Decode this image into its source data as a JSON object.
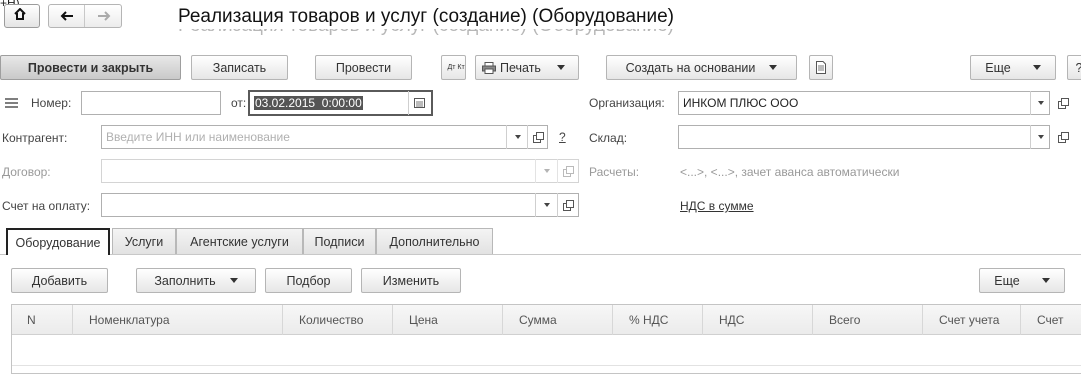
{
  "window": {
    "corner_label": "+H)",
    "title": "Реализация товаров и услуг (создание) (Оборудование)"
  },
  "toolbar": {
    "post_and_close": "Провести и закрыть",
    "save": "Записать",
    "post": "Провести",
    "dtkt_icon_text": "Дт Кт",
    "print": "Печать",
    "create_based_on": "Создать на основании",
    "more": "Еще",
    "help": "?"
  },
  "form": {
    "number_label": "Номер:",
    "number_value": "",
    "date_label": "от:",
    "date_value": "03.02.2015  0:00:00",
    "organization_label": "Организация:",
    "organization_value": "ИНКОМ ПЛЮС ООО",
    "counterparty_label": "Контрагент:",
    "counterparty_placeholder": "Введите ИНН или наименование",
    "counterparty_help": "?",
    "warehouse_label": "Склад:",
    "warehouse_value": "",
    "contract_label": "Договор:",
    "contract_value": "",
    "settlements_label": "Расчеты:",
    "settlements_value": "<...>, <...>, зачет аванса автоматически",
    "invoice_label": "Счет на оплату:",
    "invoice_value": "",
    "vat_link": "НДС в сумме"
  },
  "tabs": [
    {
      "label": "Оборудование",
      "active": true
    },
    {
      "label": "Услуги",
      "active": false
    },
    {
      "label": "Агентские услуги",
      "active": false
    },
    {
      "label": "Подписи",
      "active": false
    },
    {
      "label": "Дополнительно",
      "active": false
    }
  ],
  "table_toolbar": {
    "add": "Добавить",
    "fill": "Заполнить",
    "selection": "Подбор",
    "change": "Изменить",
    "more": "Еще"
  },
  "table": {
    "columns": [
      "N",
      "Номенклатура",
      "Количество",
      "Цена",
      "Сумма",
      "% НДС",
      "НДС",
      "Всего",
      "Счет учета",
      "Счет"
    ],
    "rows": []
  }
}
